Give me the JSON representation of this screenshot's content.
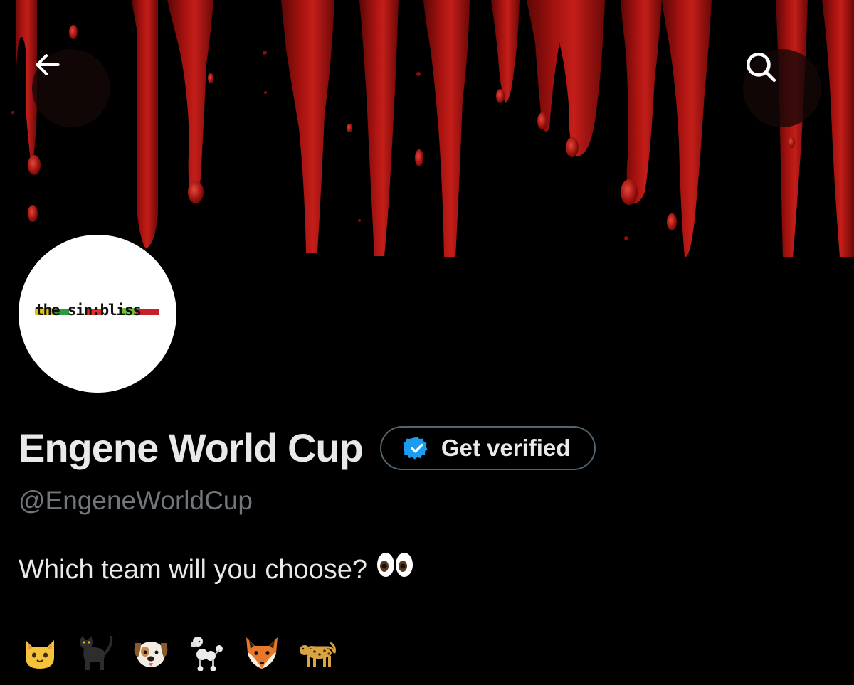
{
  "header": {
    "back_icon": "arrow-left-icon",
    "search_icon": "search-icon",
    "banner_description_icon": "dripping-blood-banner"
  },
  "avatar": {
    "logo_text": "the sin:bliss"
  },
  "profile": {
    "display_name": "Engene World Cup",
    "verify_button_label": "Get verified",
    "verify_icon": "verified-badge-icon",
    "handle": "@EngeneWorldCup",
    "bio_text": "Which team will you choose?",
    "bio_emoji": "eyes-emoji",
    "team_emojis": [
      "cat-face",
      "black-cat",
      "dog-face",
      "poodle",
      "fox-face",
      "leopard"
    ]
  },
  "colors": {
    "background": "#000000",
    "text_primary": "#e7e9ea",
    "text_secondary": "#71767b",
    "verified_blue": "#1d9bf0",
    "blood_red": "#8b0d0d",
    "pill_border": "#536471"
  }
}
